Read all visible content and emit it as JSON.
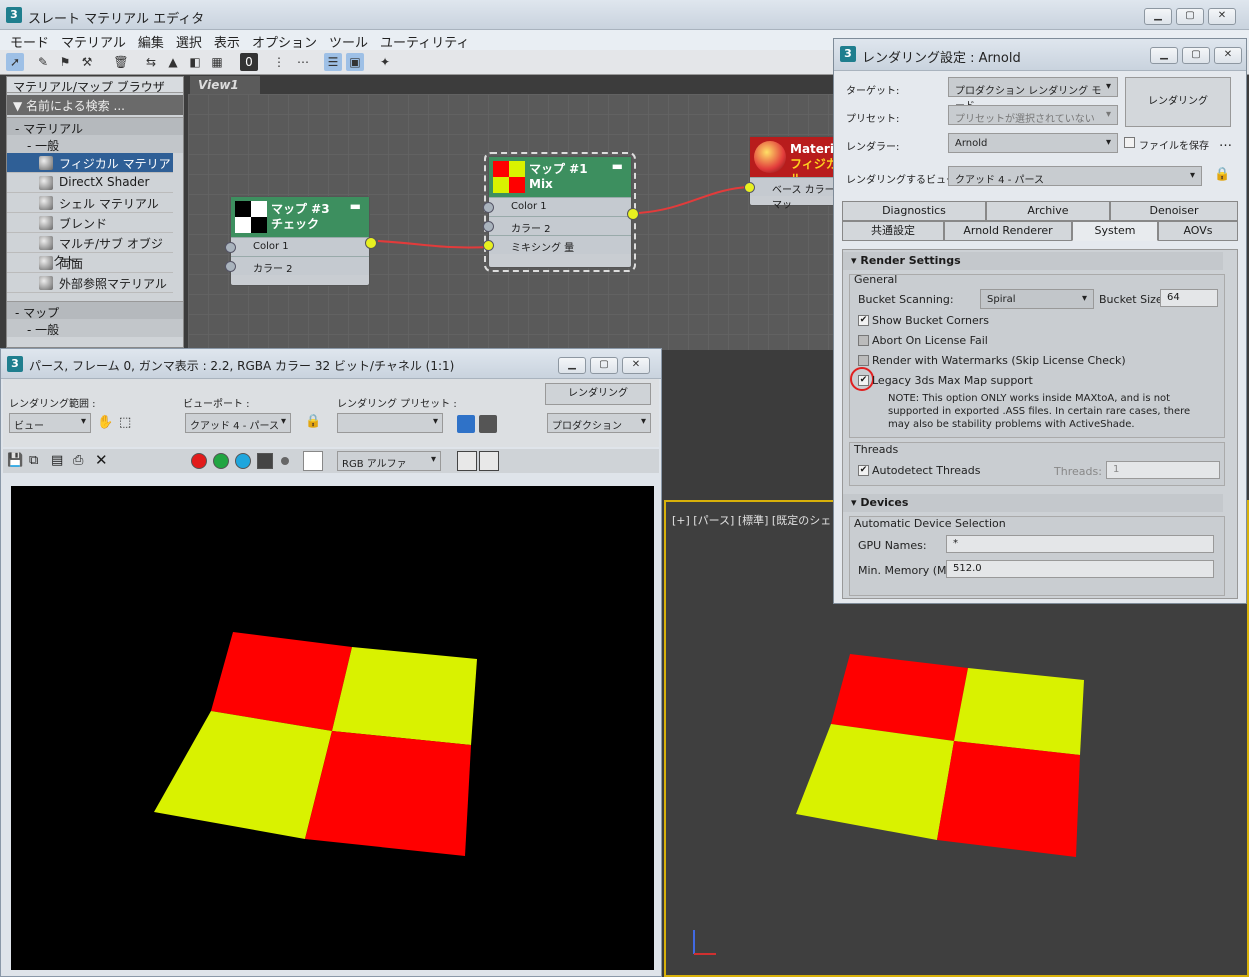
{
  "main": {
    "title": "スレート マテリアル エディタ",
    "menu": [
      "モード",
      "マテリアル",
      "編集",
      "選択",
      "表示",
      "オプション",
      "ツール",
      "ユーティリティ"
    ]
  },
  "browser": {
    "title": "マテリアル/マップ ブラウザ",
    "search": "名前による検索 ...",
    "group1": "- マテリアル",
    "sub1": "- 一般",
    "items": [
      "フィジカル マテリアル",
      "DirectX Shader",
      "シェル マテリアル",
      "ブレンド",
      "マルチ/サブ オブジェクト",
      "両面",
      "外部参照マテリアル"
    ],
    "group2": "- マップ",
    "sub2": "- 一般"
  },
  "view": {
    "tab": "View1"
  },
  "nodes": {
    "map3": {
      "title": "マップ #3",
      "sub": "チェック",
      "slots": [
        "Color 1",
        "カラー 2"
      ]
    },
    "map1": {
      "title": "マップ #1",
      "sub": "Mix",
      "slots": [
        "Color 1",
        "カラー 2",
        "ミキシング 量"
      ]
    },
    "mat": {
      "title": "Materia",
      "sub": "フィジカル",
      "slot": "ベース カラー マッ"
    }
  },
  "framebuffer": {
    "title": "パース, フレーム 0, ガンマ表示 : 2.2, RGBA カラー 32 ビット/チャネル (1:1)",
    "area_label": "レンダリング範囲 :",
    "area_value": "ビュー",
    "viewport_label": "ビューポート :",
    "viewport_value": "クアッド 4 - パース",
    "preset_label": "レンダリング プリセット :",
    "preset_value": "",
    "render_btn": "レンダリング",
    "production": "プロダクション",
    "channel": "RGB アルファ"
  },
  "viewport": {
    "label": "[+] [パース] [標準] [既定のシェ"
  },
  "render_settings": {
    "title": "レンダリング設定 : Arnold",
    "target_label": "ターゲット:",
    "target_value": "プロダクション レンダリング モード",
    "preset_label": "プリセット:",
    "preset_value": "プリセットが選択されていない",
    "renderer_label": "レンダラー:",
    "renderer_value": "Arnold",
    "save_file": "ファイルを保存",
    "view_label": "レンダリングするビュー:",
    "view_value": "クアッド 4 - パース",
    "render_btn": "レンダリング",
    "tabs_row1": [
      "Diagnostics",
      "Archive",
      "Denoiser"
    ],
    "tabs_row2": [
      "共通設定",
      "Arnold Renderer",
      "System",
      "AOVs"
    ],
    "render_settings_header": "Render Settings",
    "general": "General",
    "bucket_scanning_label": "Bucket Scanning:",
    "bucket_scanning_value": "Spiral",
    "bucket_size_label": "Bucket Size:",
    "bucket_size_value": "64",
    "show_bucket_corners": "Show Bucket Corners",
    "abort_license": "Abort On License Fail",
    "render_watermarks": "Render with Watermarks (Skip License Check)",
    "legacy_map": "Legacy 3ds Max Map support",
    "note": "NOTE: This option ONLY works inside MAXtoA, and is not supported in exported .ASS files. In certain rare cases, there may also be stability problems with ActiveShade.",
    "threads": "Threads",
    "autodetect": "Autodetect Threads",
    "threads_label": "Threads:",
    "threads_value": "1",
    "devices_header": "Devices",
    "auto_device": "Automatic Device Selection",
    "gpu_label": "GPU Names:",
    "gpu_value": "*",
    "minmem_label": "Min. Memory (MB):",
    "minmem_value": "512.0"
  },
  "colors": {
    "red": "#ff0000",
    "yellow": "#d9f200",
    "node_green": "#3d8f5f",
    "wire": "#e23b3b",
    "highlight_circle": "#e02020"
  }
}
